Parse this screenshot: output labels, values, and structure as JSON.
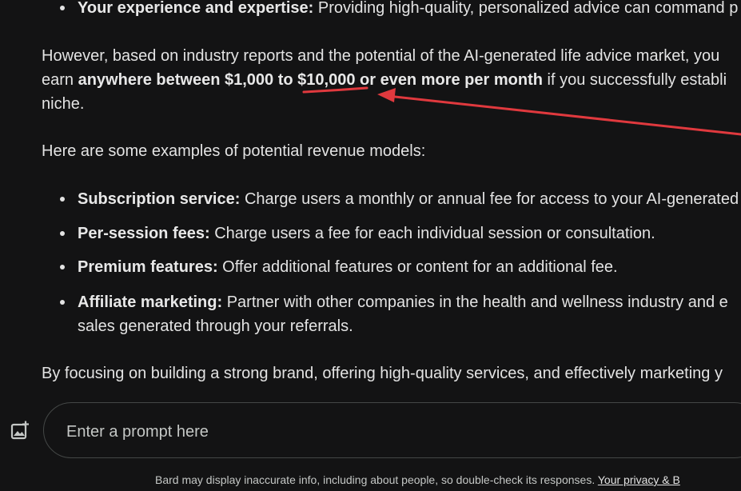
{
  "response": {
    "top_bullet": {
      "label": "Your experience and expertise:",
      "text": " Providing high-quality, personalized advice can command p"
    },
    "para1": {
      "line1": "However, based on industry reports and the potential of the AI-generated life advice market, you",
      "line2_pre": "earn ",
      "line2_bold1": "anywhere between $1,000 to ",
      "line2_highlight": "$10,000",
      "line2_bold2": " or even more per month",
      "line2_post": " if you successfully establi",
      "line3": "niche."
    },
    "intro": "Here are some examples of potential revenue models:",
    "models": [
      {
        "label": "Subscription service:",
        "text": " Charge users a monthly or annual fee for access to your AI-generated"
      },
      {
        "label": "Per-session fees:",
        "text": " Charge users a fee for each individual session or consultation."
      },
      {
        "label": "Premium features:",
        "text": " Offer additional features or content for an additional fee."
      },
      {
        "label": "Affiliate marketing:",
        "text": " Partner with other companies in the health and wellness industry and e",
        "text2": "sales generated through your referrals."
      }
    ],
    "closing": "By focusing on building a strong brand, offering high-quality services, and effectively marketing y"
  },
  "composer": {
    "image_icon": "add-image-icon",
    "placeholder": "Enter a prompt here",
    "value": ""
  },
  "footer": {
    "disclaimer": "Bard may display inaccurate info, including about people, so double-check its responses. ",
    "privacy_link": "Your privacy & B"
  },
  "annotation": {
    "color": "#e0393e",
    "icon": "red-arrow-annotation"
  }
}
